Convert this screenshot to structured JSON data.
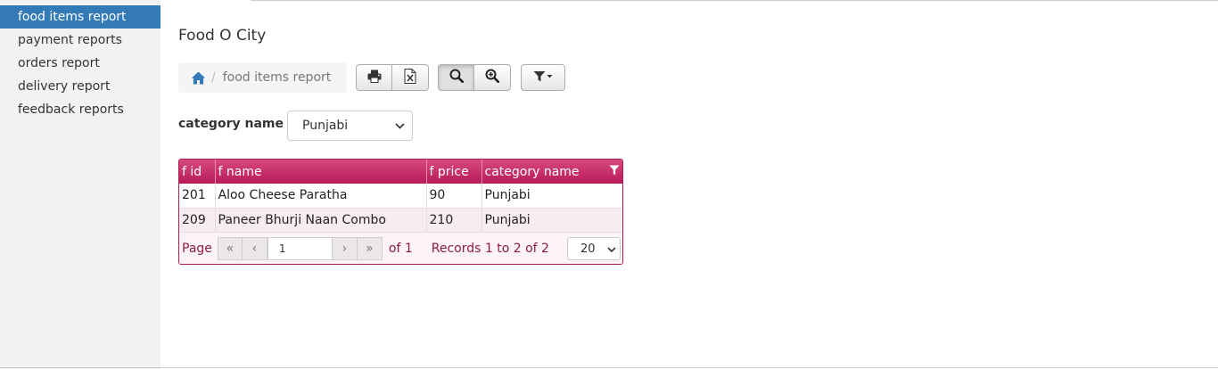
{
  "sidebar": {
    "items": [
      {
        "label": "food items report"
      },
      {
        "label": "payment reports"
      },
      {
        "label": "orders report"
      },
      {
        "label": "delivery report"
      },
      {
        "label": "feedback reports"
      }
    ]
  },
  "app_title": "Food O City",
  "breadcrumb": {
    "current": "food items report",
    "separator": "/"
  },
  "toolbar": {
    "icons": [
      "print-icon",
      "excel-export-icon",
      "search-icon",
      "zoom-icon",
      "filter-dropdown-icon"
    ]
  },
  "filter": {
    "label": "category name",
    "selected": "Punjabi"
  },
  "table": {
    "columns": [
      "f id",
      "f name",
      "f price",
      "category name"
    ],
    "rows": [
      [
        "201",
        "Aloo Cheese Paratha",
        "90",
        "Punjabi"
      ],
      [
        "209",
        "Paneer Bhurji Naan Combo",
        "210",
        "Punjabi"
      ]
    ]
  },
  "pager": {
    "page_label": "Page",
    "page_value": "1",
    "of_text": "of 1",
    "records_text": "Records 1 to 2 of 2",
    "page_size": "20"
  },
  "colors": {
    "accent": "#337ab7",
    "grid_header": "#b8195a",
    "grid_text": "#8e1a44"
  }
}
